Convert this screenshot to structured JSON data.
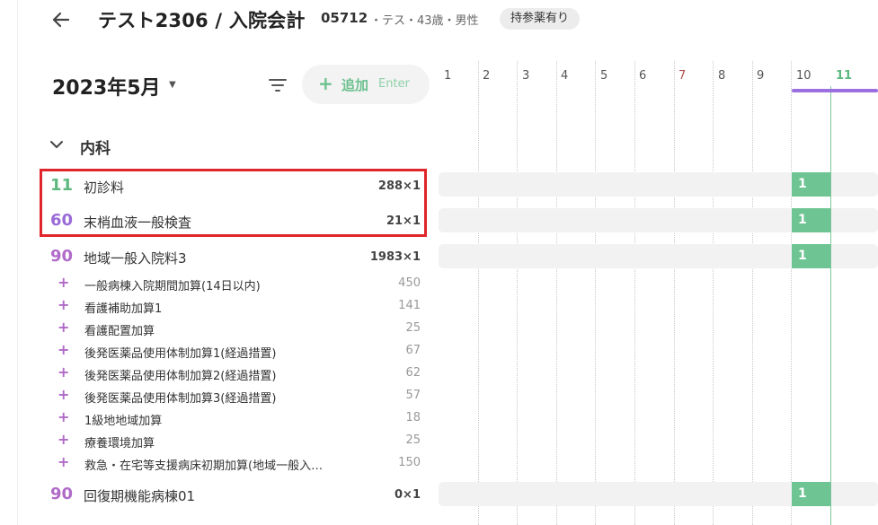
{
  "header": {
    "title": "テスト2306 / 入院会計",
    "patient_id": "05712",
    "patient_info": "・テス・43歳・男性",
    "badge": "持参薬有り"
  },
  "controls": {
    "month": "2023年5月",
    "add_label": "追加",
    "add_shortcut": "Enter",
    "add_icon": "plus-icon",
    "filter_icon": "filter-icon"
  },
  "section": {
    "title": "内科",
    "expanded": true
  },
  "items": [
    {
      "code": "11",
      "name": "初診料",
      "points": "288×1",
      "color": "#5cb87e",
      "cell": "1"
    },
    {
      "code": "60",
      "name": "末梢血液一般検査",
      "points": "21×1",
      "color": "#9a6bd6",
      "cell": "1"
    },
    {
      "code": "90",
      "name": "地域一般入院料3",
      "points": "1983×1",
      "color": "#b06ac8",
      "cell": "1"
    }
  ],
  "subitems": [
    {
      "name": "一般病棟入院期間加算(14日以内)",
      "value": "450"
    },
    {
      "name": "看護補助加算1",
      "value": "141"
    },
    {
      "name": "看護配置加算",
      "value": "25"
    },
    {
      "name": "後発医薬品使用体制加算1(経過措置)",
      "value": "67"
    },
    {
      "name": "後発医薬品使用体制加算2(経過措置)",
      "value": "62"
    },
    {
      "name": "後発医薬品使用体制加算3(経過措置)",
      "value": "57"
    },
    {
      "name": "1級地地域加算",
      "value": "18"
    },
    {
      "name": "療養環境加算",
      "value": "25"
    },
    {
      "name": "救急・在宅等支援病床初期加算(地域一般入…",
      "value": "150"
    }
  ],
  "last_item": {
    "code": "90",
    "name": "回復期機能病棟01",
    "points": "0×1",
    "color": "#b06ac8",
    "cell": "1"
  },
  "calendar": {
    "days": [
      "1",
      "2",
      "3",
      "4",
      "5",
      "6",
      "7",
      "8",
      "9",
      "10",
      "11"
    ],
    "selected_day": "10",
    "today": "11",
    "colors": {
      "normal": "#555555",
      "sunday": "#b05050",
      "today": "#5cb87e",
      "selected": "#9b6fe0"
    }
  }
}
